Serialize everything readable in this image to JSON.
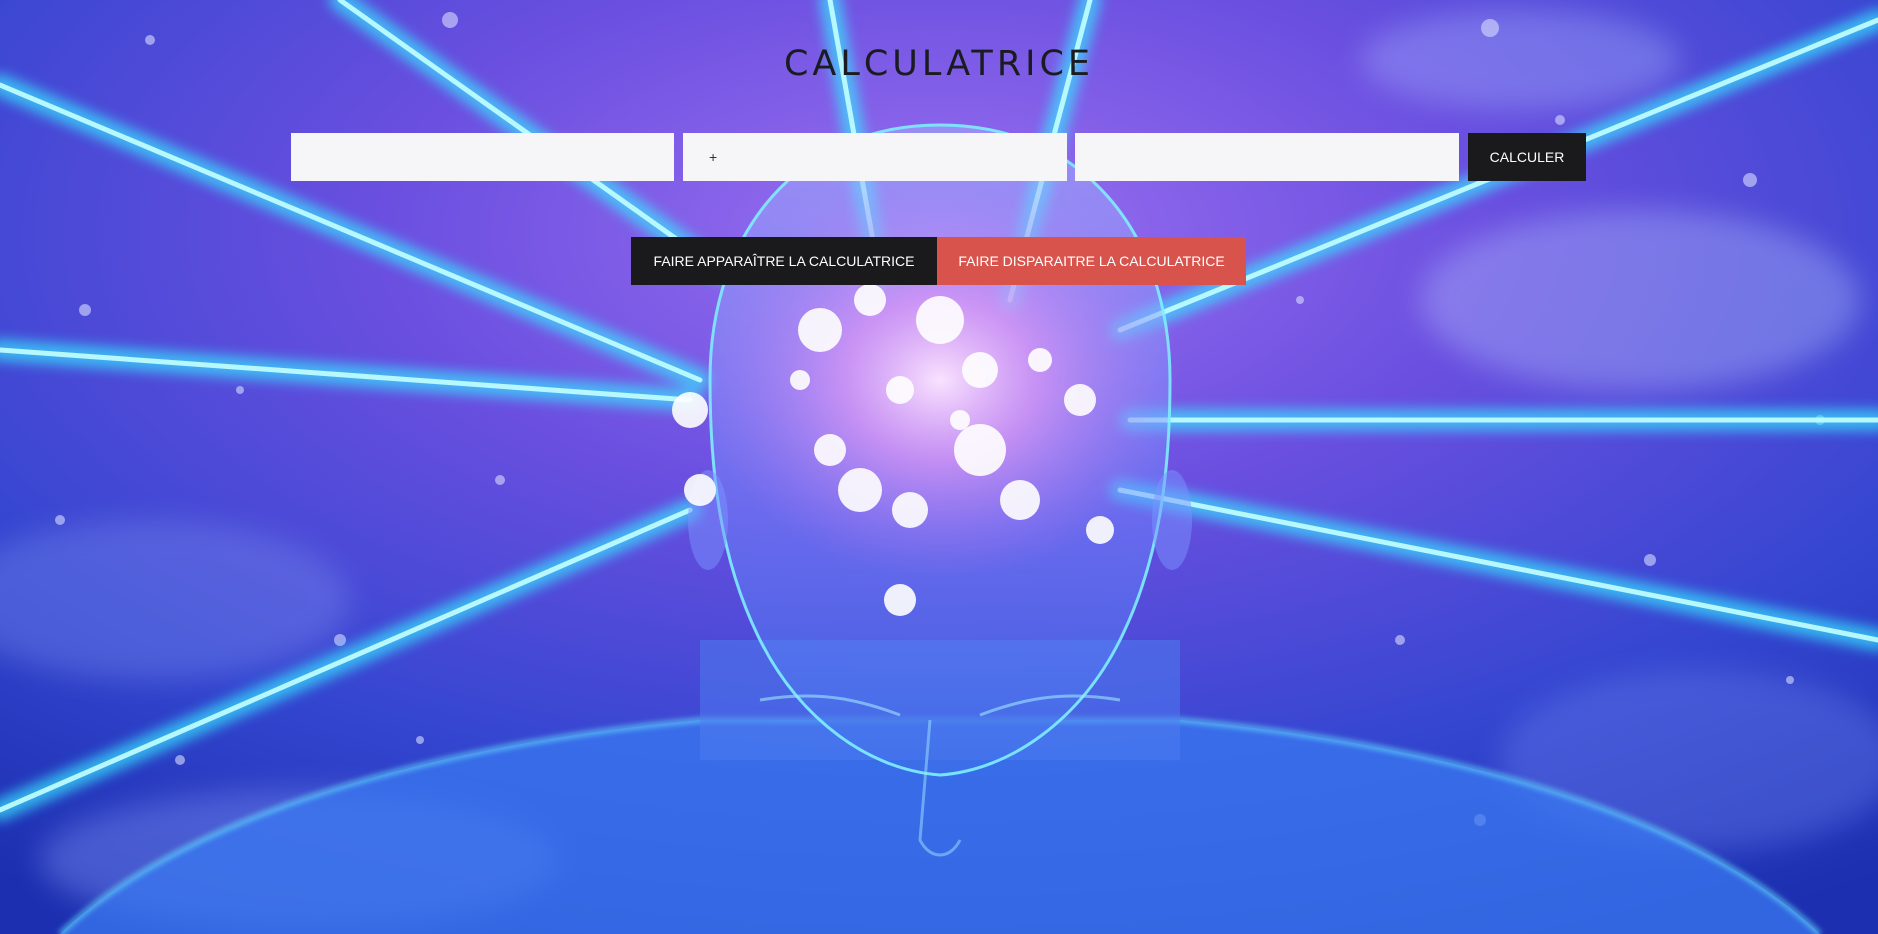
{
  "page": {
    "title": "CALCULATRICE"
  },
  "calculator": {
    "operand1": {
      "value": "",
      "placeholder": ""
    },
    "operator": {
      "value": "+",
      "placeholder": ""
    },
    "operand2": {
      "value": "",
      "placeholder": ""
    },
    "calculate_label": "CALCULER"
  },
  "toggle": {
    "show_label": "FAIRE APPARAÎTRE LA CALCULATRICE",
    "hide_label": "FAIRE DISPARAITRE LA CALCULATRICE"
  },
  "colors": {
    "title_text": "#1b1b22",
    "field_bg": "#f6f5f8",
    "dark_button": "#1a1a1c",
    "red_button": "#d8534c",
    "background_blue": "#2a3fc4",
    "background_purple": "#8a5ae0",
    "laser_cyan": "#5ff4ff"
  },
  "background": {
    "image_subject": "glowing-head-brain-laser-beams"
  }
}
